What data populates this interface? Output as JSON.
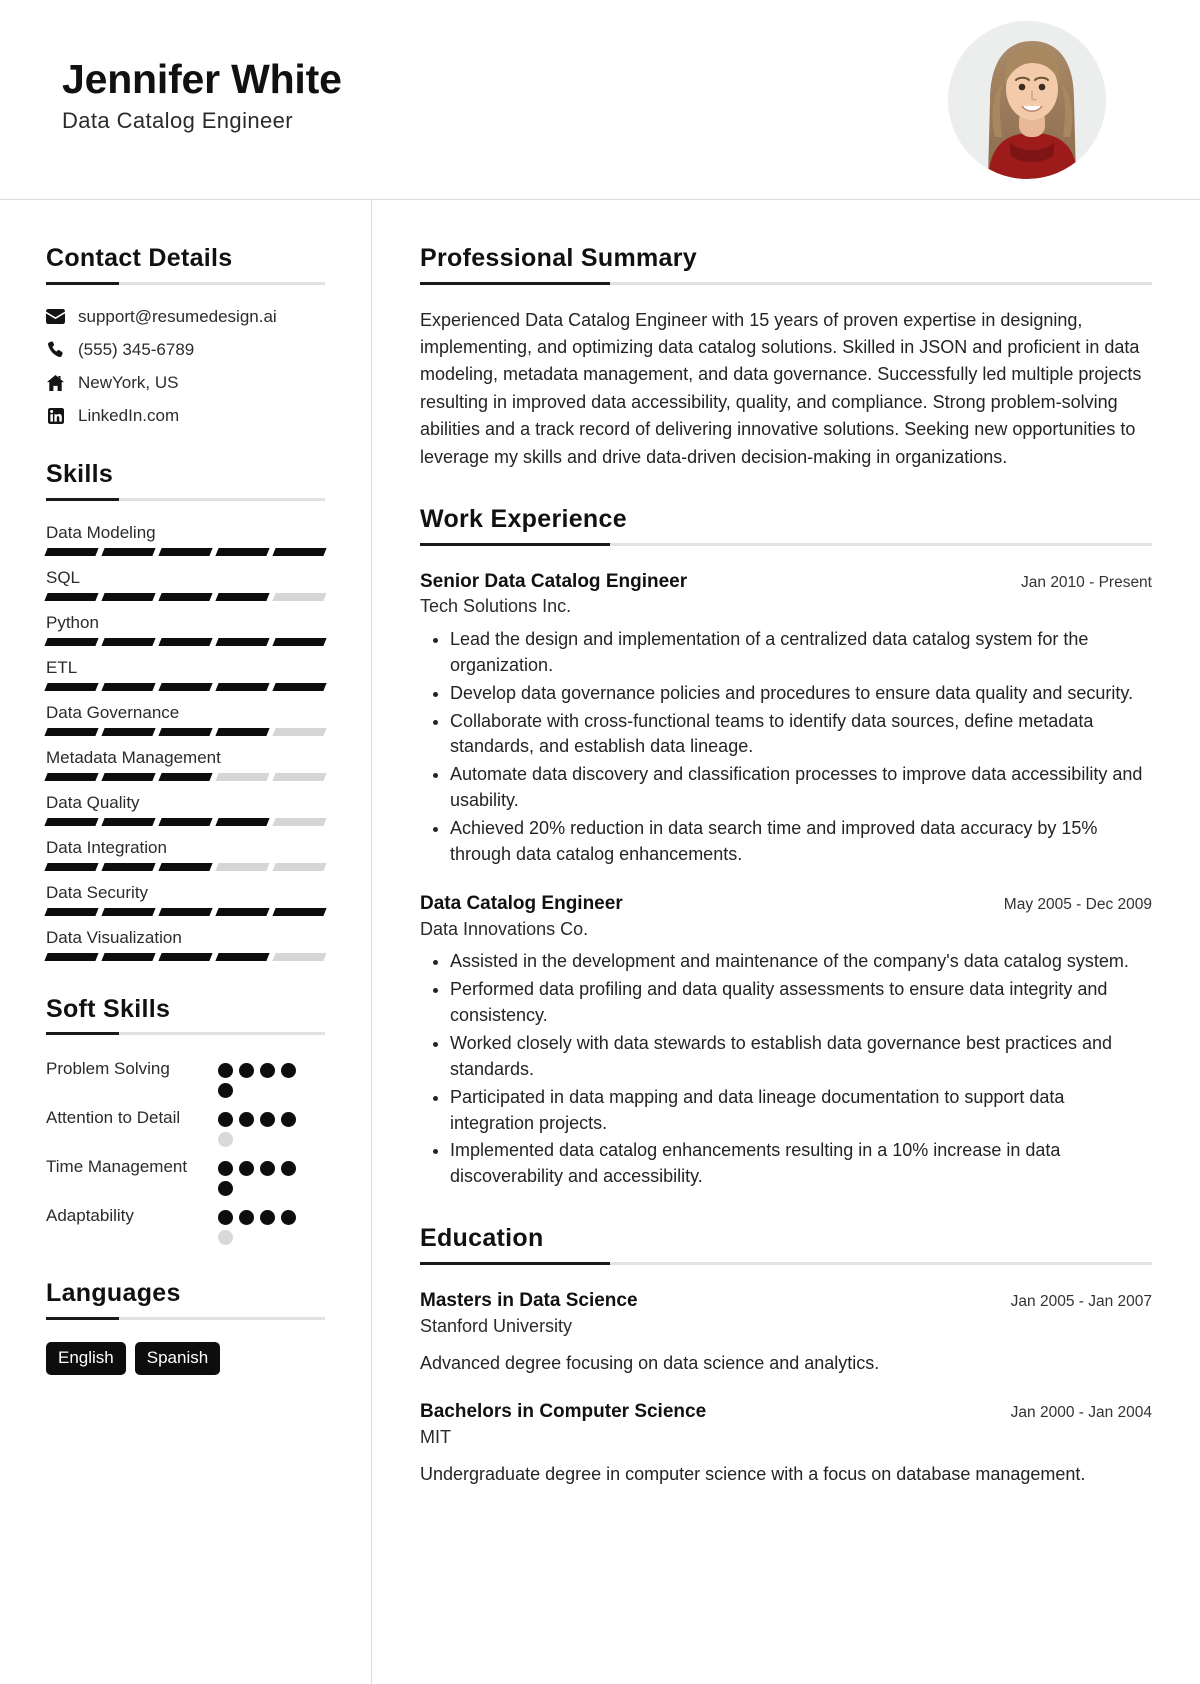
{
  "header": {
    "name": "Jennifer White",
    "title": "Data Catalog Engineer",
    "avatar_alt": "profile-photo"
  },
  "sidebar": {
    "contact": {
      "heading": "Contact Details",
      "items": [
        {
          "icon": "envelope-icon",
          "value": "support@resumedesign.ai"
        },
        {
          "icon": "phone-icon",
          "value": "(555) 345-6789"
        },
        {
          "icon": "home-icon",
          "value": "NewYork, US"
        },
        {
          "icon": "linkedin-icon",
          "value": "LinkedIn.com"
        }
      ]
    },
    "skills": {
      "heading": "Skills",
      "max": 5,
      "items": [
        {
          "name": "Data Modeling",
          "level": 5
        },
        {
          "name": "SQL",
          "level": 4
        },
        {
          "name": "Python",
          "level": 5
        },
        {
          "name": "ETL",
          "level": 5
        },
        {
          "name": "Data Governance",
          "level": 4
        },
        {
          "name": "Metadata Management",
          "level": 3
        },
        {
          "name": "Data Quality",
          "level": 4
        },
        {
          "name": "Data Integration",
          "level": 3
        },
        {
          "name": "Data Security",
          "level": 5
        },
        {
          "name": "Data Visualization",
          "level": 4
        }
      ]
    },
    "soft_skills": {
      "heading": "Soft Skills",
      "max": 5,
      "items": [
        {
          "name": "Problem Solving",
          "level": 5
        },
        {
          "name": "Attention to Detail",
          "level": 4
        },
        {
          "name": "Time Management",
          "level": 5
        },
        {
          "name": "Adaptability",
          "level": 4
        }
      ]
    },
    "languages": {
      "heading": "Languages",
      "items": [
        "English",
        "Spanish"
      ]
    }
  },
  "main": {
    "summary": {
      "heading": "Professional Summary",
      "text": "Experienced Data Catalog Engineer with 15 years of proven expertise in designing, implementing, and optimizing data catalog solutions. Skilled in JSON and proficient in data modeling, metadata management, and data governance. Successfully led multiple projects resulting in improved data accessibility, quality, and compliance. Strong problem-solving abilities and a track record of delivering innovative solutions. Seeking new opportunities to leverage my skills and drive data-driven decision-making in organizations."
    },
    "experience": {
      "heading": "Work Experience",
      "items": [
        {
          "role": "Senior Data Catalog Engineer",
          "date": "Jan 2010 - Present",
          "org": "Tech Solutions Inc.",
          "bullets": [
            "Lead the design and implementation of a centralized data catalog system for the organization.",
            "Develop data governance policies and procedures to ensure data quality and security.",
            "Collaborate with cross-functional teams to identify data sources, define metadata standards, and establish data lineage.",
            "Automate data discovery and classification processes to improve data accessibility and usability.",
            "Achieved 20% reduction in data search time and improved data accuracy by 15% through data catalog enhancements."
          ]
        },
        {
          "role": "Data Catalog Engineer",
          "date": "May 2005 - Dec 2009",
          "org": "Data Innovations Co.",
          "bullets": [
            "Assisted in the development and maintenance of the company's data catalog system.",
            "Performed data profiling and data quality assessments to ensure data integrity and consistency.",
            "Worked closely with data stewards to establish data governance best practices and standards.",
            "Participated in data mapping and data lineage documentation to support data integration projects.",
            "Implemented data catalog enhancements resulting in a 10% increase in data discoverability and accessibility."
          ]
        }
      ]
    },
    "education": {
      "heading": "Education",
      "items": [
        {
          "degree": "Masters in Data Science",
          "date": "Jan 2005 - Jan 2007",
          "school": "Stanford University",
          "description": "Advanced degree focusing on data science and analytics."
        },
        {
          "degree": "Bachelors in Computer Science",
          "date": "Jan 2000 - Jan 2004",
          "school": "MIT",
          "description": "Undergraduate degree in computer science with a focus on database management."
        }
      ]
    }
  },
  "colors": {
    "accent": "#0d0d0d",
    "muted_bar": "#d6d6d6",
    "rule": "#e2e2e2",
    "text": "#242424"
  }
}
